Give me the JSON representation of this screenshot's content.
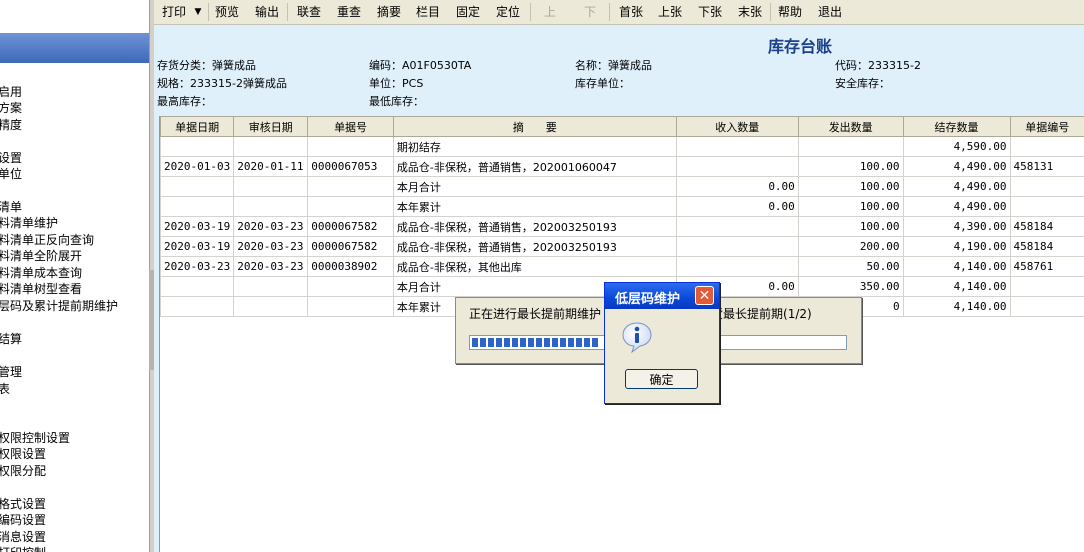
{
  "nav": {
    "items": [
      "启用",
      "方案",
      "精度",
      "设置",
      "单位",
      "清单",
      "料清单维护",
      "料清单正反向查询",
      "料清单全阶展开",
      "料清单成本查询",
      "料清单树型查看",
      "层码及累计提前期维护",
      "结算",
      "管理",
      "表",
      "权限控制设置",
      "权限设置",
      "权限分配",
      "格式设置",
      "编码设置",
      "消息设置",
      "打印控制"
    ]
  },
  "toolbar": {
    "print": "打印",
    "print_arrow": "▼",
    "preview": "预览",
    "output": "输出",
    "query": "联查",
    "requery": "重查",
    "summary": "摘要",
    "columns": "栏目",
    "fix": "固定",
    "locate": "定位",
    "up": "上",
    "down": "下",
    "first": "首张",
    "prev": "上张",
    "next": "下张",
    "last": "末张",
    "help": "帮助",
    "exit": "退出"
  },
  "report": {
    "title": "库存台账",
    "category": "存货分类：弹簧成品",
    "code": "编码：A01F0530TA",
    "name": "名称：弹簧成品",
    "alias_code": "代码：233315-2",
    "spec": "规格：233315-2弹簧成品",
    "unit": "单位：PCS",
    "stock_unit": "库存单位：",
    "safe_stock": "安全库存：",
    "max_stock": "最高库存：",
    "min_stock": "最低库存："
  },
  "grid": {
    "headers": [
      "单据日期",
      "审核日期",
      "单据号",
      "摘　　要",
      "收入数量",
      "发出数量",
      "结存数量",
      "单据编号"
    ],
    "rows": [
      [
        "",
        "",
        "",
        "期初结存",
        "",
        "",
        "4,590.00",
        ""
      ],
      [
        "2020-01-03",
        "2020-01-11",
        "0000067053",
        "成品仓-非保税，普通销售，202001060047",
        "",
        "100.00",
        "4,490.00",
        "458131"
      ],
      [
        "",
        "",
        "",
        "本月合计",
        "0.00",
        "100.00",
        "4,490.00",
        ""
      ],
      [
        "",
        "",
        "",
        "本年累计",
        "0.00",
        "100.00",
        "4,490.00",
        ""
      ],
      [
        "2020-03-19",
        "2020-03-23",
        "0000067582",
        "成品仓-非保税，普通销售，202003250193",
        "",
        "100.00",
        "4,390.00",
        "458184"
      ],
      [
        "2020-03-19",
        "2020-03-23",
        "0000067582",
        "成品仓-非保税，普通销售，202003250193",
        "",
        "200.00",
        "4,190.00",
        "458184"
      ],
      [
        "2020-03-23",
        "2020-03-23",
        "0000038902",
        "成品仓-非保税，其他出库",
        "",
        "50.00",
        "4,140.00",
        "458761"
      ],
      [
        "",
        "",
        "",
        "本月合计",
        "0.00",
        "350.00",
        "4,140.00",
        ""
      ],
      [
        "",
        "",
        "",
        "本年累计",
        "",
        "0",
        "4,140.00",
        ""
      ]
    ]
  },
  "progress": {
    "text_left": "正在进行最长提前期维护",
    "text_right": "货最长提前期(1/2)",
    "fraction": 0.33
  },
  "msgbox": {
    "title": "低层码维护",
    "close": "✕",
    "icon": "info-icon",
    "ok": "确定"
  }
}
